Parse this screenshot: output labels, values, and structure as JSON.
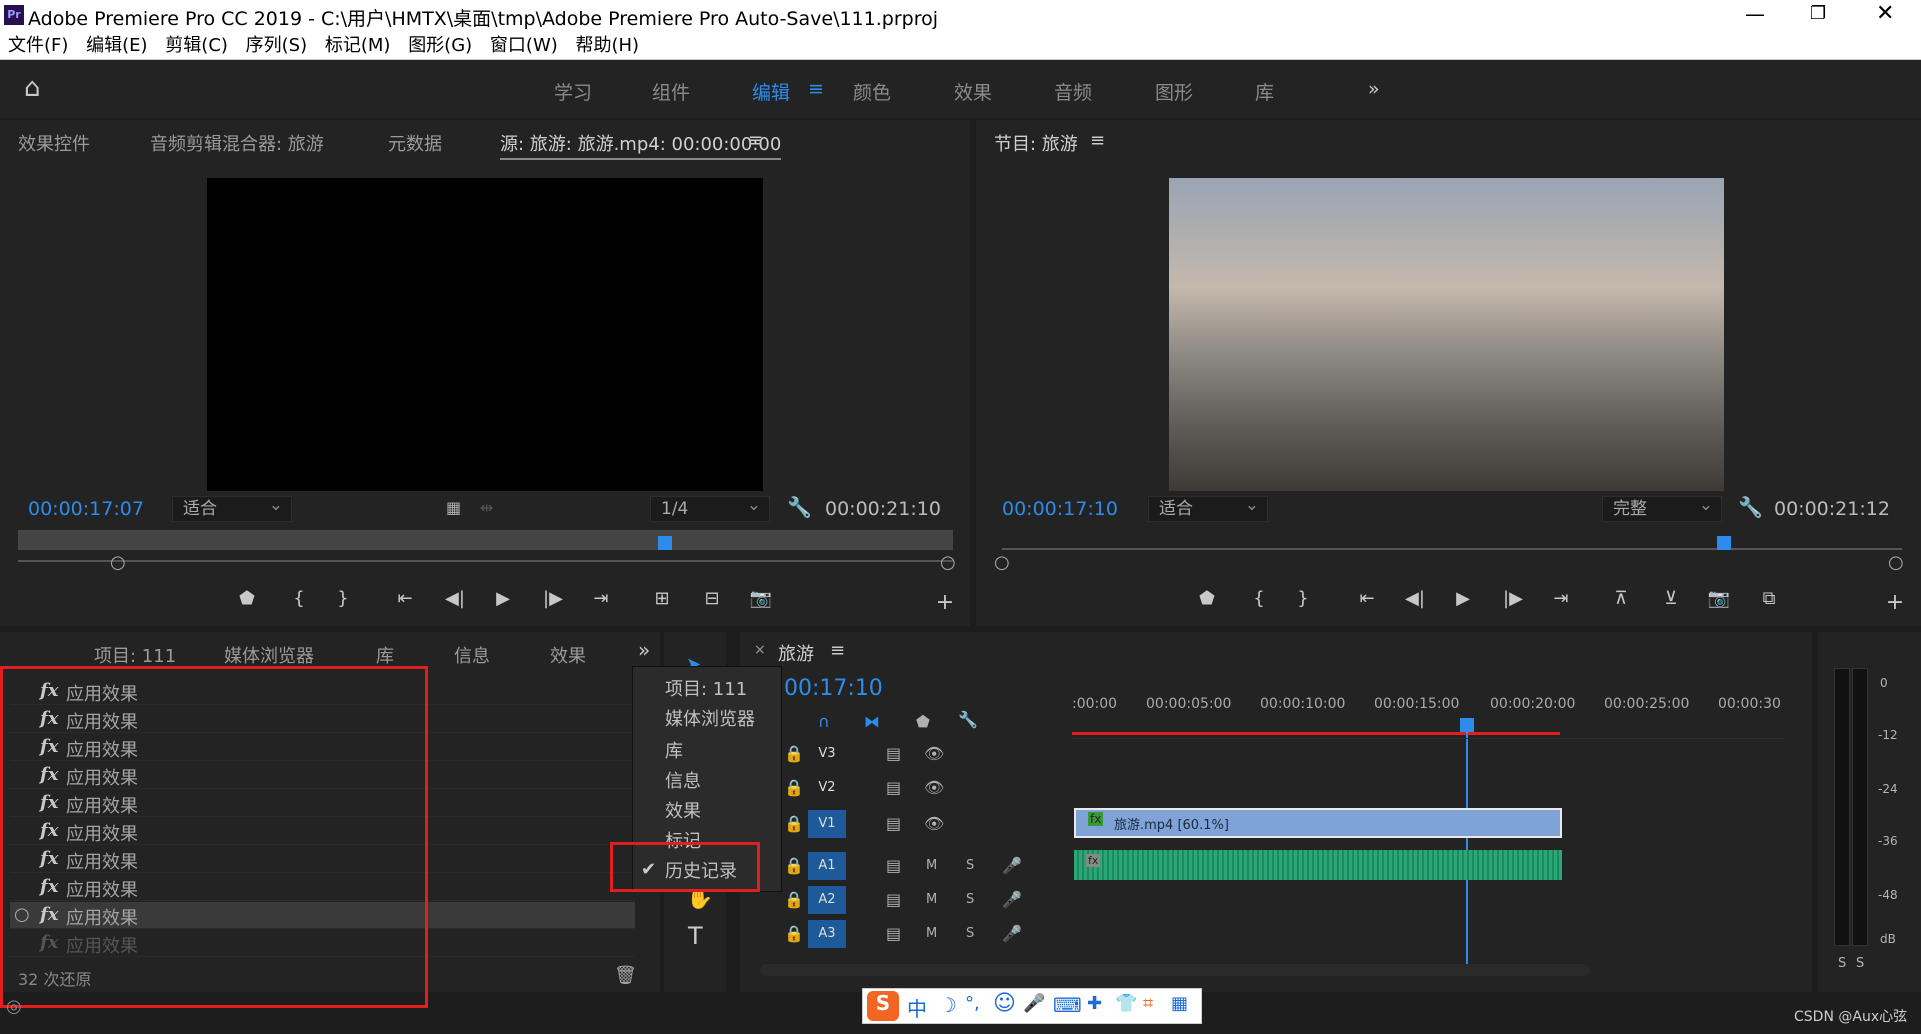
{
  "window": {
    "title": "Adobe Premiere Pro CC 2019 - C:\\用户\\HMTX\\桌面\\tmp\\Adobe Premiere Pro Auto-Save\\111.prproj",
    "app_icon": "Pr"
  },
  "menu": [
    "文件(F)",
    "编辑(E)",
    "剪辑(C)",
    "序列(S)",
    "标记(M)",
    "图形(G)",
    "窗口(W)",
    "帮助(H)"
  ],
  "workspaces": [
    "学习",
    "组件",
    "编辑",
    "颜色",
    "效果",
    "音频",
    "图形",
    "库"
  ],
  "active_workspace": "编辑",
  "source": {
    "tabs": [
      "效果控件",
      "音频剪辑混合器: 旅游",
      "元数据",
      "源: 旅游: 旅游.mp4: 00:00:00:00"
    ],
    "timecode": "00:00:17:07",
    "fit": "适合",
    "res": "1/4",
    "duration": "00:00:21:10"
  },
  "program": {
    "tab": "节目: 旅游",
    "timecode": "00:00:17:10",
    "fit": "适合",
    "quality": "完整",
    "duration": "00:00:21:12"
  },
  "project": {
    "tabs": [
      "项目: 111",
      "媒体浏览器",
      "库",
      "信息",
      "效果"
    ],
    "history_items": [
      "应用效果",
      "应用效果",
      "应用效果",
      "应用效果",
      "应用效果",
      "应用效果",
      "应用效果",
      "应用效果",
      "应用效果",
      "应用效果"
    ],
    "status": "32 次还原"
  },
  "popup_menu": {
    "items": [
      "项目: 111",
      "媒体浏览器",
      "库",
      "信息",
      "效果",
      "标记"
    ],
    "checked": "历史记录"
  },
  "timeline": {
    "tab": "旅游",
    "timecode": "00:17:10",
    "ruler": [
      ":00:00",
      "00:00:05:00",
      "00:00:10:00",
      "00:00:15:00",
      "00:00:20:00",
      "00:00:25:00",
      "00:00:30"
    ],
    "video_tracks": [
      "V3",
      "V2",
      "V1"
    ],
    "audio_tracks": [
      "A1",
      "A2",
      "A3"
    ],
    "clip": "旅游.mp4 [60.1%]",
    "m": "M",
    "s": "S"
  },
  "meter": {
    "ticks": [
      "0",
      "-12",
      "-24",
      "-36",
      "-48",
      "dB"
    ],
    "solo": [
      "S",
      "S"
    ]
  },
  "watermark": "CSDN @Aux心弦",
  "ime": [
    "中",
    "☽",
    "°,",
    "☺",
    "🎤",
    "⌨"
  ],
  "colors": {
    "accent": "#2d8ceb",
    "highlight_red": "#e02020",
    "clip_video": "#7fa3d6",
    "clip_audio": "#2aa776"
  }
}
